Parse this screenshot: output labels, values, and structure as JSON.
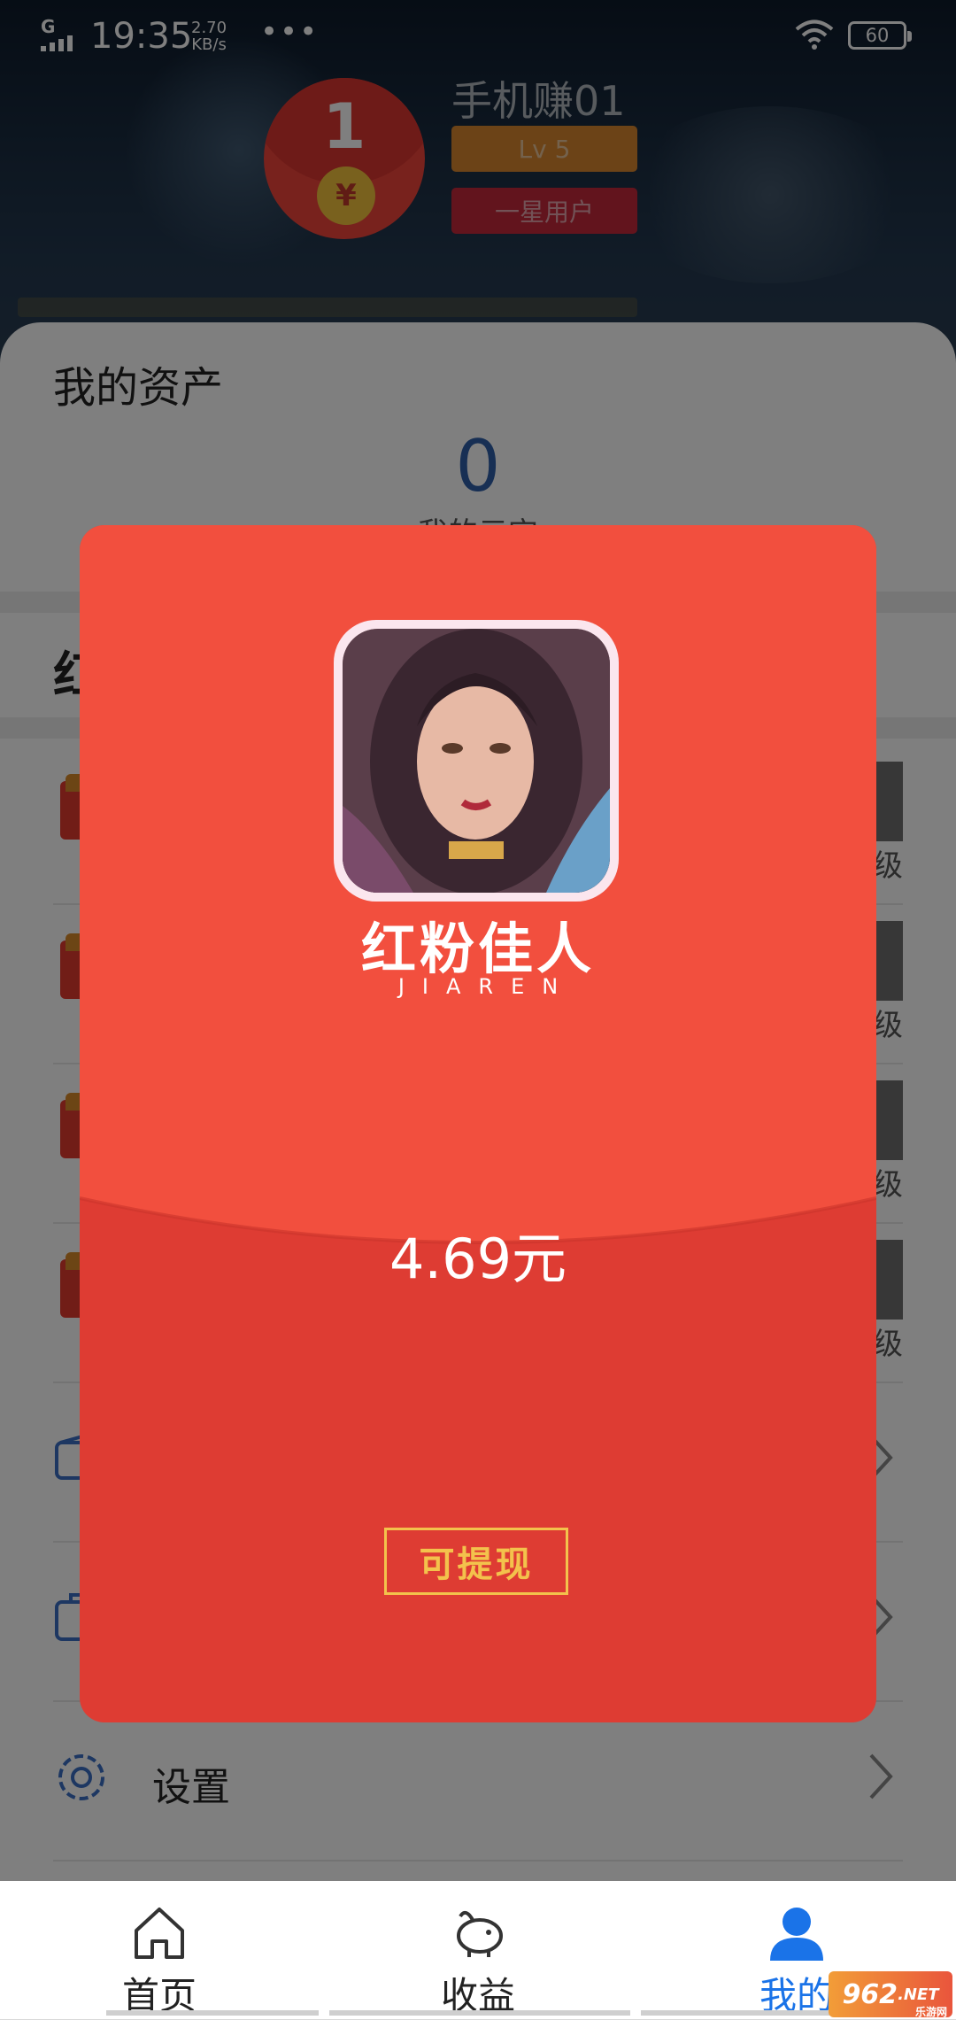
{
  "status_bar": {
    "network": "G",
    "time": "19:35",
    "speed_value": "2.70",
    "speed_unit": "KB/s",
    "more": "•••",
    "battery": "60"
  },
  "profile": {
    "username": "手机赚01",
    "level": "Lv 5",
    "rank": "一星用户",
    "avatar_number": "1",
    "avatar_coin": "¥"
  },
  "assets": {
    "title": "我的资产",
    "value": "0",
    "subtitle": "我的元宝"
  },
  "section": {
    "title_char": "红"
  },
  "game_rows": [
    {
      "level_text": "级"
    },
    {
      "level_text": "级"
    },
    {
      "level_text": "级"
    },
    {
      "level_text": "级"
    }
  ],
  "settings_row": {
    "label": "设置"
  },
  "modal": {
    "game_name_cn": "红粉佳人",
    "game_name_en": "JIAREN",
    "amount": "4.69元",
    "withdraw_label": "可提现",
    "colors": {
      "top": "#f24f3e",
      "bottom": "#de3c33",
      "button": "#f3c24c"
    }
  },
  "bottom_nav": {
    "items": [
      {
        "label": "首页",
        "icon": "home-icon"
      },
      {
        "label": "收益",
        "icon": "piggy-bank-icon"
      },
      {
        "label": "我的",
        "icon": "user-icon"
      }
    ],
    "active_index": 2,
    "active_color": "#1a73e8"
  },
  "watermark": {
    "text": "962",
    "suffix": ".NET",
    "sub": "乐游网"
  }
}
